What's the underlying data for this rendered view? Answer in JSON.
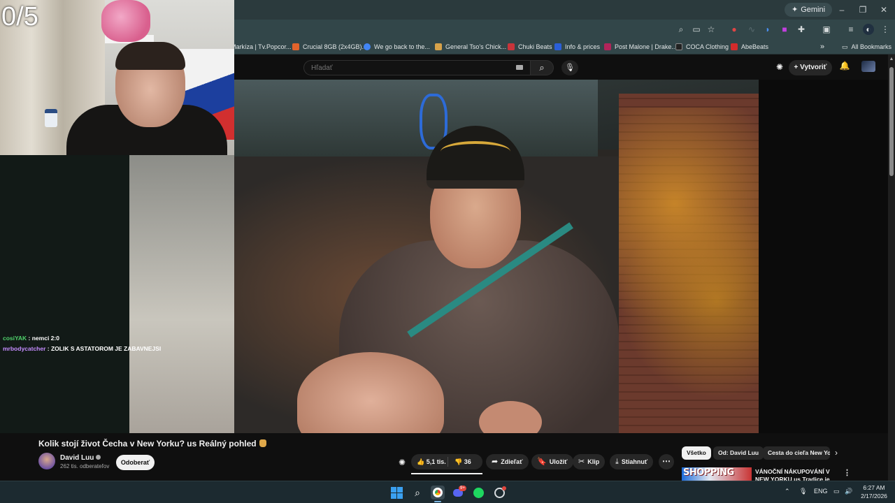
{
  "browser": {
    "gemini_label": "Gemini",
    "window_controls": [
      "–",
      "❐",
      "✕"
    ],
    "bookmarks": [
      {
        "label": "Markíza | Tv.Popcor...",
        "color": "#3a3a3a"
      },
      {
        "label": "Crucial 8GB (2x4GB)...",
        "color": "#e2632b"
      },
      {
        "label": "We go back to the...",
        "color": "#4285f4"
      },
      {
        "label": "General Tso's Chick...",
        "color": "#d7a24a"
      },
      {
        "label": "Chuki Beats",
        "color": "#c8343a"
      },
      {
        "label": "Info & prices",
        "color": "#2a5fd8"
      },
      {
        "label": "Post Malone | Drake...",
        "color": "#b2245a"
      },
      {
        "label": "COCA Clothing",
        "color": "#222222"
      },
      {
        "label": "AbeBeats",
        "color": "#d32b2b"
      }
    ],
    "more_bookmarks": "»",
    "all_bookmarks": "All Bookmarks"
  },
  "youtube": {
    "search_placeholder": "Hľadať",
    "create_label": "Vytvoriť",
    "video_title": "Kolik stojí život Čecha v New Yorku? us Reálný pohled",
    "channel_name": "David Luu",
    "subscribers": "262 tis. odberateľov",
    "subscribe_label": "Odoberať",
    "likes": "5,1 tis.",
    "dislikes": "36",
    "share_label": "Zdieľať",
    "save_label": "Uložiť",
    "clip_label": "Klip",
    "download_label": "Stiahnuť",
    "chips": [
      "Všetko",
      "Od: David Luu",
      "Cesta do cieľa New Yo"
    ],
    "rec_thumb_text": "SHOPPING",
    "rec_title": "VÁNOČNÍ NÁKUPOVÁNÍ V NEW YORKU us Tradice je tradice"
  },
  "stream": {
    "counter": "0/5",
    "chat": [
      {
        "user": "cosiYAK",
        "user_color": "#4fd16b",
        "text": " : nemci 2:0"
      },
      {
        "user": "mrbodycatcher",
        "user_color": "#c58cff",
        "text": " : ZOLIK S ASTATOROM JE ZABAVNEJSI"
      }
    ]
  },
  "taskbar": {
    "language": "ENG",
    "time": "6:27 AM",
    "date": "2/17/2026",
    "discord_badge": "9+"
  }
}
